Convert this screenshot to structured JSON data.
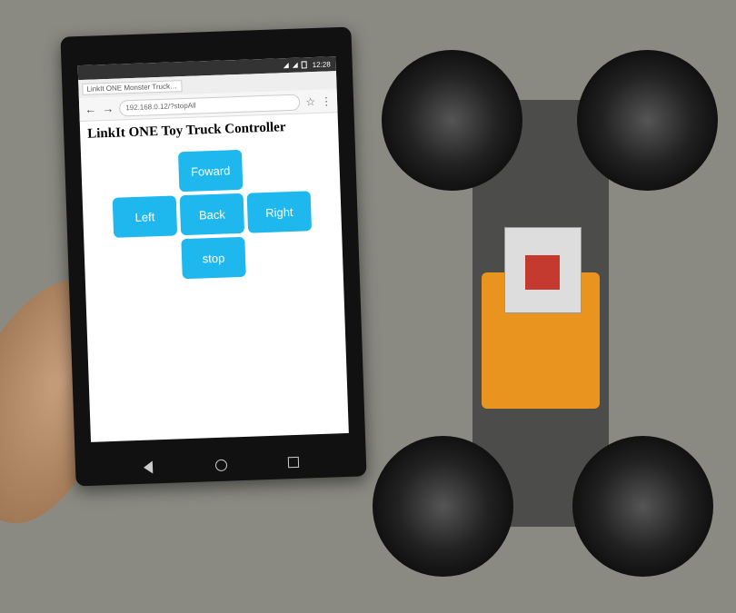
{
  "status_bar": {
    "time": "12:28"
  },
  "browser": {
    "tab_title": "LinkIt ONE Monster Truck C...",
    "url": "192.168.0.12/?stopAll"
  },
  "page": {
    "title": "LinkIt ONE Toy Truck Controller"
  },
  "controls": {
    "forward": "Foward",
    "left": "Left",
    "back": "Back",
    "right": "Right",
    "stop": "stop"
  }
}
